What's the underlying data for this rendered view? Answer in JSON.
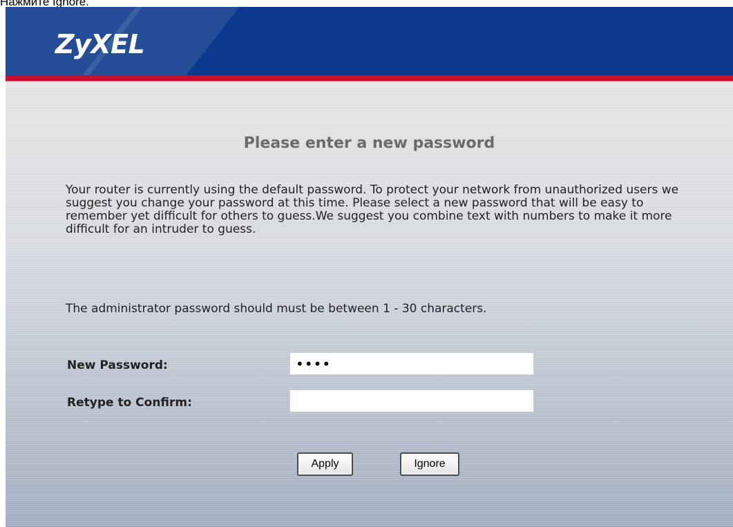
{
  "caption": "Нажмите Ignore.",
  "header": {
    "logo": "ZyXEL"
  },
  "page": {
    "title": "Please enter a new password",
    "intro": "Your router is currently using the default password. To protect your network from unauthorized users we suggest you change your password at this time. Please select a new password that will be easy to remember yet difficult for others to guess.We suggest you combine text with numbers to make it more difficult for an intruder to guess.",
    "rule": "The administrator password should must be between 1 - 30 characters."
  },
  "form": {
    "new_password_label": "New Password:",
    "new_password_value": "••••",
    "confirm_label": "Retype to Confirm:",
    "confirm_value": ""
  },
  "buttons": {
    "apply": "Apply",
    "ignore": "Ignore"
  },
  "colors": {
    "header_bg": "#0b3a8c",
    "accent_bar": "#c8102e",
    "title_text": "#6b6b6b"
  }
}
